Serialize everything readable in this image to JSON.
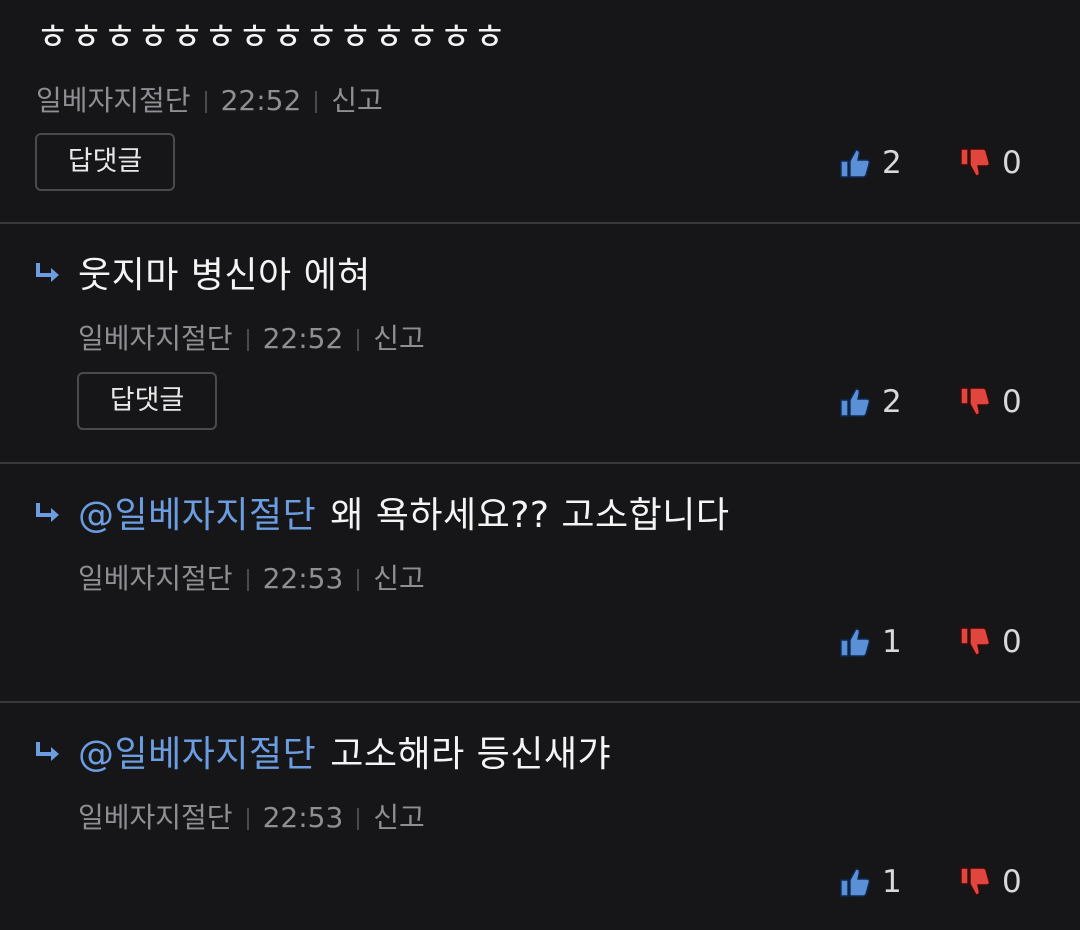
{
  "comments": [
    {
      "text": "ㅎㅎㅎㅎㅎㅎㅎㅎㅎㅎㅎㅎㅎㅎ",
      "author": "일베자지절단",
      "time": "22:52",
      "report": "신고",
      "reply_button": "답댓글",
      "likes": "2",
      "dislikes": "0"
    },
    {
      "text": "웃지마 병신아 에혀",
      "author": "일베자지절단",
      "time": "22:52",
      "report": "신고",
      "reply_button": "답댓글",
      "likes": "2",
      "dislikes": "0"
    },
    {
      "mention": "@일베자지절단",
      "text": "왜 욕하세요?? 고소합니다",
      "author": "일베자지절단",
      "time": "22:53",
      "report": "신고",
      "likes": "1",
      "dislikes": "0"
    },
    {
      "mention": "@일베자지절단",
      "text": "고소해라 등신새갸",
      "author": "일베자지절단",
      "time": "22:53",
      "report": "신고",
      "likes": "1",
      "dislikes": "0"
    }
  ],
  "colors": {
    "background": "#161618",
    "mention": "#6b9de0",
    "thumb_up": "#5b8fd6",
    "thumb_down": "#e0463e"
  },
  "icons": {
    "reply": "reply-arrow-icon",
    "like": "thumbs-up-icon",
    "dislike": "thumbs-down-icon"
  }
}
